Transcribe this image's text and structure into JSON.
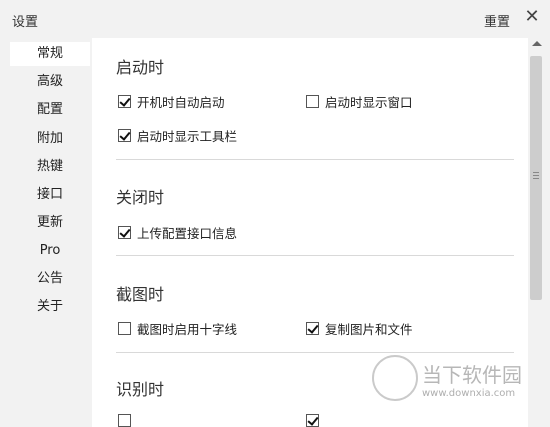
{
  "window": {
    "title": "设置",
    "reset_label": "重置",
    "close_glyph": "✕"
  },
  "sidebar": {
    "items": [
      {
        "label": "常规"
      },
      {
        "label": "高级"
      },
      {
        "label": "配置"
      },
      {
        "label": "附加"
      },
      {
        "label": "热键"
      },
      {
        "label": "接口"
      },
      {
        "label": "更新"
      },
      {
        "label": "Pro"
      },
      {
        "label": "公告"
      },
      {
        "label": "关于"
      }
    ],
    "selected": "常规"
  },
  "sections": {
    "startup": {
      "title": "启动时",
      "options": [
        {
          "label": "开机时自动启动",
          "checked": true
        },
        {
          "label": "启动时显示窗口",
          "checked": false
        },
        {
          "label": "启动时显示工具栏",
          "checked": true
        }
      ]
    },
    "close": {
      "title": "关闭时",
      "options": [
        {
          "label": "上传配置接口信息",
          "checked": true
        }
      ]
    },
    "screenshot": {
      "title": "截图时",
      "options": [
        {
          "label": "截图时启用十字线",
          "checked": false
        },
        {
          "label": "复制图片和文件",
          "checked": true
        }
      ]
    },
    "recognize": {
      "title": "识别时"
    }
  },
  "watermark": {
    "text": "当下软件园",
    "url": "www.downxia.com"
  },
  "colors": {
    "window_bg": "#f2f2f2",
    "content_bg": "#ffffff",
    "sidebar_selected": "#ffffff"
  }
}
